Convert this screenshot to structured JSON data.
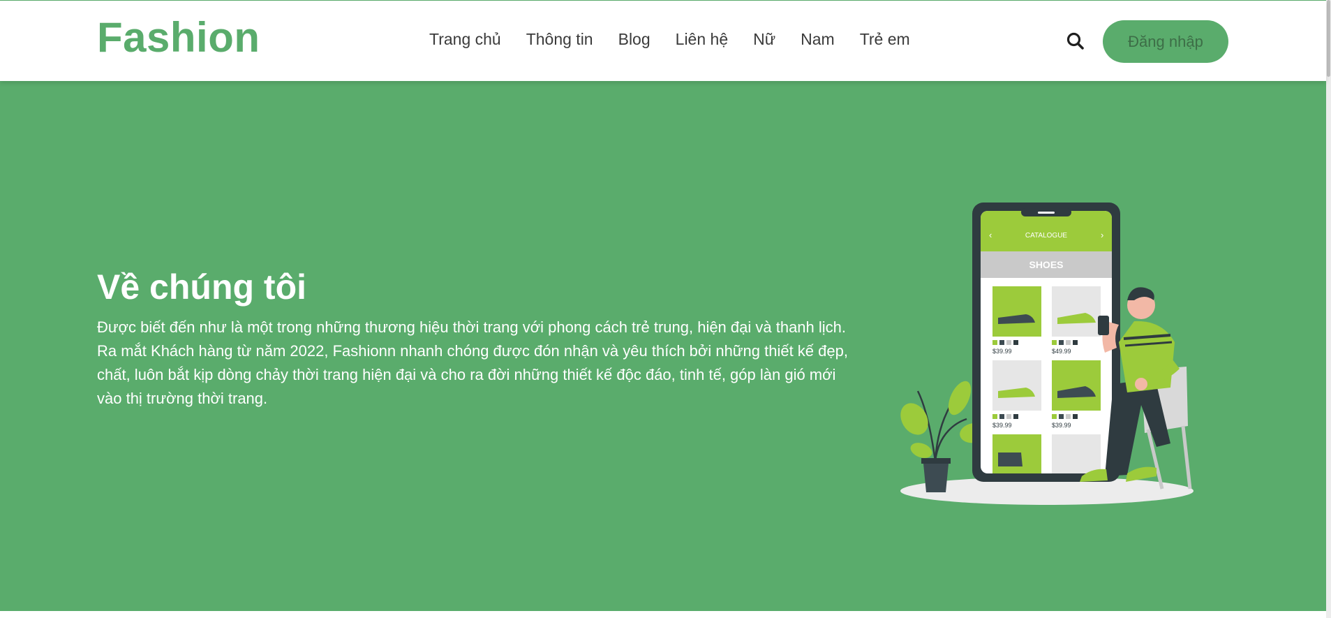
{
  "header": {
    "logo": "Fashion",
    "nav": [
      "Trang chủ",
      "Thông tin",
      "Blog",
      "Liên hệ",
      "Nữ",
      "Nam",
      "Trẻ em"
    ],
    "search_icon": "search-icon",
    "login_label": "Đăng nhập"
  },
  "hero": {
    "title": "Về chúng tôi",
    "paragraph": "Được biết đến như là một trong những thương hiệu thời trang với phong cách trẻ trung, hiện đại và thanh lịch. Ra mắt Khách hàng từ năm 2022, Fashionn nhanh chóng được đón nhận và yêu thích bởi những thiết kế đẹp, chất, luôn bắt kịp dòng chảy thời trang hiện đại và cho ra đời những thiết kế độc đáo, tinh tế, góp làn gió mới vào thị trường thời trang."
  },
  "illustration": {
    "app_header": "CATALOGUE",
    "category": "SHOES",
    "prices": [
      "$39.99",
      "$49.99",
      "$39.99",
      "$39.99"
    ]
  },
  "colors": {
    "brand_green": "#5aac6c",
    "lime": "#9ccb3b",
    "dark": "#2f3b40"
  }
}
